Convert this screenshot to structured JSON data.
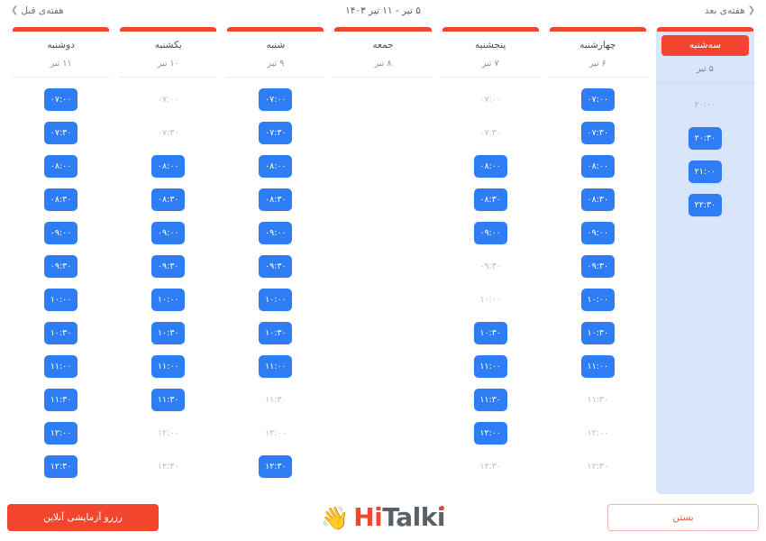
{
  "header": {
    "prev_week_label": "هفته‌ی قبل",
    "prev_week_chevron": "❯",
    "next_week_label": "هفته‌ی بعد",
    "next_week_chevron": "❮",
    "title": "۵ تیر - ۱۱ تیر ۱۴۰۳"
  },
  "colors": {
    "accent_red": "#f4452f",
    "slot_blue": "#2f7df4",
    "active_column_bg": "#d9e5fb",
    "disabled_text": "#b9bdc4"
  },
  "days": [
    {
      "name": "سه‌شنبه",
      "date": "۵ تیر",
      "active": true,
      "slots": [
        {
          "time": "۲۰:۰۰",
          "available": false
        },
        {
          "time": "۲۰:۳۰",
          "available": true
        },
        {
          "time": "۲۱:۰۰",
          "available": true
        },
        {
          "time": "۲۲:۳۰",
          "available": true
        }
      ]
    },
    {
      "name": "چهارشنبه",
      "date": "۶ تیر",
      "active": false,
      "slots": [
        {
          "time": "۰۷:۰۰",
          "available": true
        },
        {
          "time": "۰۷:۳۰",
          "available": true
        },
        {
          "time": "۰۸:۰۰",
          "available": true
        },
        {
          "time": "۰۸:۳۰",
          "available": true
        },
        {
          "time": "۰۹:۰۰",
          "available": true
        },
        {
          "time": "۰۹:۳۰",
          "available": true
        },
        {
          "time": "۱۰:۰۰",
          "available": true
        },
        {
          "time": "۱۰:۳۰",
          "available": true
        },
        {
          "time": "۱۱:۰۰",
          "available": true
        },
        {
          "time": "۱۱:۳۰",
          "available": false
        },
        {
          "time": "۱۲:۰۰",
          "available": false
        },
        {
          "time": "۱۲:۳۰",
          "available": false
        }
      ]
    },
    {
      "name": "پنجشنبه",
      "date": "۷ تیر",
      "active": false,
      "slots": [
        {
          "time": "۰۷:۰۰",
          "available": false
        },
        {
          "time": "۰۷:۳۰",
          "available": false
        },
        {
          "time": "۰۸:۰۰",
          "available": true
        },
        {
          "time": "۰۸:۳۰",
          "available": true
        },
        {
          "time": "۰۹:۰۰",
          "available": true
        },
        {
          "time": "۰۹:۳۰",
          "available": false
        },
        {
          "time": "۱۰:۰۰",
          "available": false
        },
        {
          "time": "۱۰:۳۰",
          "available": true
        },
        {
          "time": "۱۱:۰۰",
          "available": true
        },
        {
          "time": "۱۱:۳۰",
          "available": true
        },
        {
          "time": "۱۲:۰۰",
          "available": true
        },
        {
          "time": "۱۲:۳۰",
          "available": false
        }
      ]
    },
    {
      "name": "جمعه",
      "date": "۸ تیر",
      "active": false,
      "slots": []
    },
    {
      "name": "شنبه",
      "date": "۹ تیر",
      "active": false,
      "slots": [
        {
          "time": "۰۷:۰۰",
          "available": true
        },
        {
          "time": "۰۷:۳۰",
          "available": true
        },
        {
          "time": "۰۸:۰۰",
          "available": true
        },
        {
          "time": "۰۸:۳۰",
          "available": true
        },
        {
          "time": "۰۹:۰۰",
          "available": true
        },
        {
          "time": "۰۹:۳۰",
          "available": true
        },
        {
          "time": "۱۰:۰۰",
          "available": true
        },
        {
          "time": "۱۰:۳۰",
          "available": true
        },
        {
          "time": "۱۱:۰۰",
          "available": true
        },
        {
          "time": "۱۱:۳۰",
          "available": false
        },
        {
          "time": "۱۲:۰۰",
          "available": false
        },
        {
          "time": "۱۲:۳۰",
          "available": true
        }
      ]
    },
    {
      "name": "یکشنبه",
      "date": "۱۰ تیر",
      "active": false,
      "slots": [
        {
          "time": "۰۷:۰۰",
          "available": false
        },
        {
          "time": "۰۷:۳۰",
          "available": false
        },
        {
          "time": "۰۸:۰۰",
          "available": true
        },
        {
          "time": "۰۸:۳۰",
          "available": true
        },
        {
          "time": "۰۹:۰۰",
          "available": true
        },
        {
          "time": "۰۹:۳۰",
          "available": true
        },
        {
          "time": "۱۰:۰۰",
          "available": true
        },
        {
          "time": "۱۰:۳۰",
          "available": true
        },
        {
          "time": "۱۱:۰۰",
          "available": true
        },
        {
          "time": "۱۱:۳۰",
          "available": true
        },
        {
          "time": "۱۲:۰۰",
          "available": false
        },
        {
          "time": "۱۲:۳۰",
          "available": false
        }
      ]
    },
    {
      "name": "دوشنبه",
      "date": "۱۱ تیر",
      "active": false,
      "slots": [
        {
          "time": "۰۷:۰۰",
          "available": true
        },
        {
          "time": "۰۷:۳۰",
          "available": true
        },
        {
          "time": "۰۸:۰۰",
          "available": true
        },
        {
          "time": "۰۸:۳۰",
          "available": true
        },
        {
          "time": "۰۹:۰۰",
          "available": true
        },
        {
          "time": "۰۹:۳۰",
          "available": true
        },
        {
          "time": "۱۰:۰۰",
          "available": true
        },
        {
          "time": "۱۰:۳۰",
          "available": true
        },
        {
          "time": "۱۱:۰۰",
          "available": true
        },
        {
          "time": "۱۱:۳۰",
          "available": true
        },
        {
          "time": "۱۲:۰۰",
          "available": true
        },
        {
          "time": "۱۲:۳۰",
          "available": true
        }
      ]
    }
  ],
  "footer": {
    "close_label": "بستن",
    "book_label": "رزرو آزمایشی آنلاین",
    "logo": {
      "hand_icon": "👋",
      "text_hi": "Hi",
      "text_talki": "Talki"
    }
  }
}
